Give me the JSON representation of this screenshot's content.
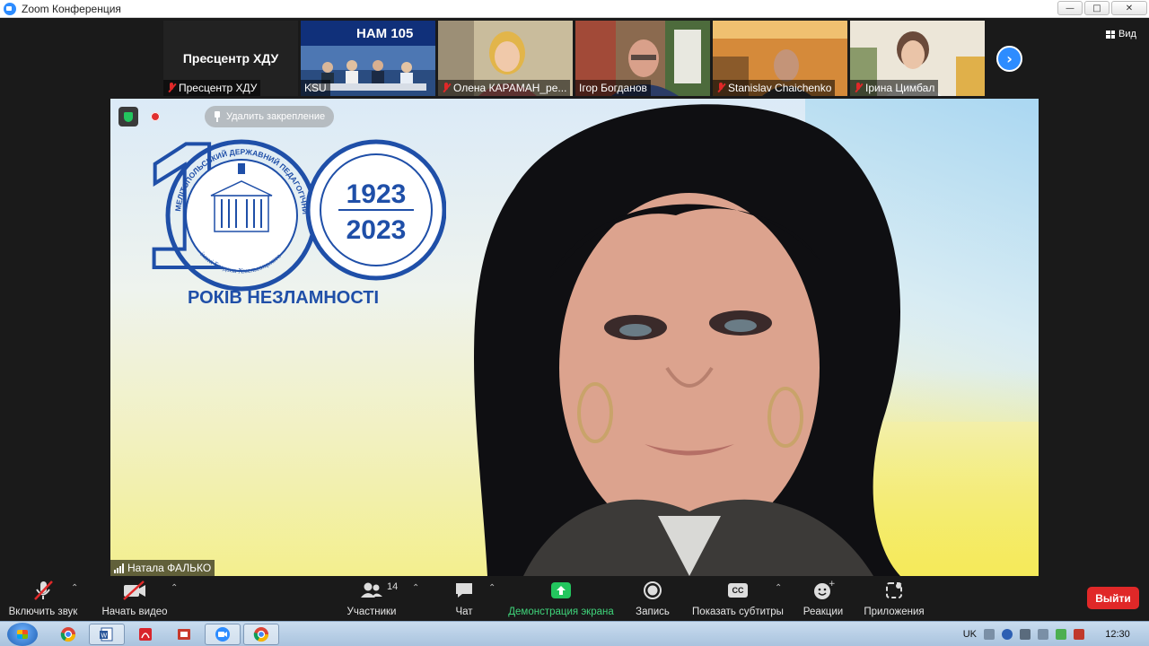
{
  "window": {
    "title": "Zoom Конференция",
    "minimize": "—",
    "maximize": "□",
    "close": "✕"
  },
  "strip": {
    "self_tile_name": "Пресцентр ХДУ",
    "tiles": [
      {
        "label": "Пресцентр ХДУ",
        "muted": true
      },
      {
        "label": "KSU",
        "muted": false,
        "banner": "НАМ 105"
      },
      {
        "label": "Олена КАРАМАН_ре...",
        "muted": true
      },
      {
        "label": "Ігор Богданов",
        "muted": false
      },
      {
        "label": "Stanislav Chaichenko",
        "muted": true
      },
      {
        "label": "Ірина Цимбал",
        "muted": true
      }
    ],
    "view_label": "Вид"
  },
  "main": {
    "unpin_label": "Удалить закрепление",
    "speaker_name": "Натала ФАЛЬКО",
    "logo": {
      "big_number": "1",
      "year_start": "1923",
      "year_end": "2023",
      "ring_text": "МЕЛІТОПОЛЬСЬКИЙ ДЕРЖАВНИЙ ПЕДАГОГІЧНИЙ УНІВЕРСИТЕТ",
      "ring_text_bottom": "імені Богдана Хмельницького",
      "slogan": "РОКІВ НЕЗЛАМНОСТІ"
    }
  },
  "toolbar": {
    "unmute": "Включить звук",
    "start_video": "Начать видео",
    "participants": "Участники",
    "participants_count": "14",
    "chat": "Чат",
    "share_screen": "Демонстрация экрана",
    "record": "Запись",
    "captions": "Показать субтитры",
    "captions_badge": "CC",
    "reactions": "Реакции",
    "apps": "Приложения",
    "leave": "Выйти",
    "caret": "⌃"
  },
  "taskbar": {
    "lang": "UK",
    "time": "12:30",
    "apps": [
      "chrome",
      "word",
      "acrobat",
      "presentation",
      "zoom",
      "chrome"
    ]
  },
  "colors": {
    "zoom_blue": "#2d8cff",
    "share_green": "#23c55e",
    "leave_red": "#e02828",
    "logo_blue": "#1f4fa8"
  }
}
